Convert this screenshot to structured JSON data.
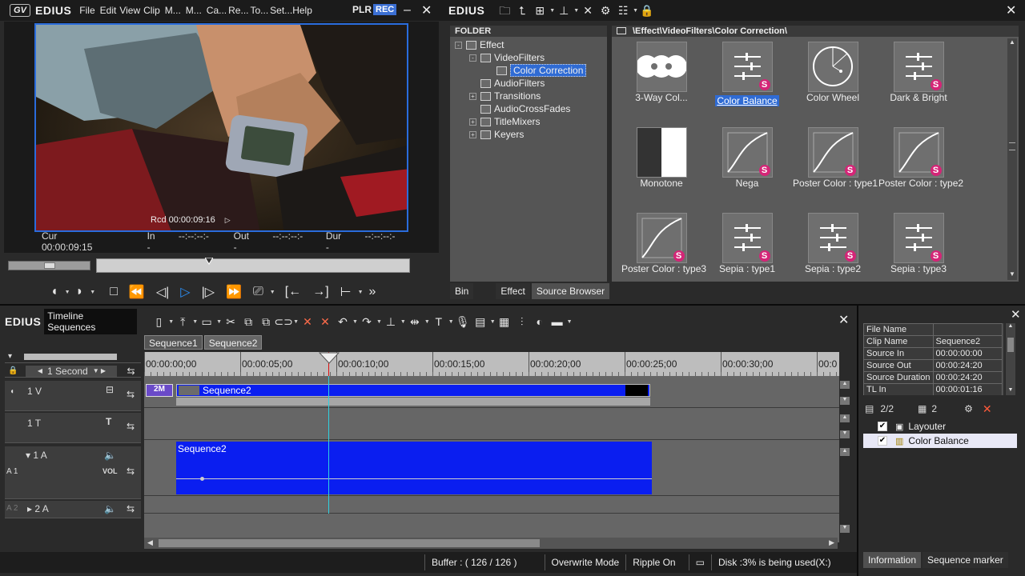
{
  "player": {
    "brand": "EDIUS",
    "logo": "GV",
    "menu": [
      "File",
      "Edit",
      "View",
      "Clip",
      "M...",
      "M...",
      "Ca...",
      "Re...",
      "To...",
      "Set...",
      "Help"
    ],
    "plr": "PLR",
    "rec": "REC",
    "overlay_tc": "Rcd 00:00:09:16",
    "cur_label": "Cur",
    "cur_value": "00:00:09:15",
    "in_label": "In",
    "in_value": "--:--:--:--",
    "out_label": "Out",
    "out_value": "--:--:--:--",
    "dur_label": "Dur",
    "dur_value": "--:--:--:--",
    "scrub_position": 0.36
  },
  "effects": {
    "brand": "EDIUS",
    "folder_header": "FOLDER",
    "path": "\\Effect\\VideoFilters\\Color Correction\\",
    "tree": [
      {
        "label": "Effect",
        "expander": "-"
      },
      {
        "label": "VideoFilters",
        "expander": "-"
      },
      {
        "label": "Color Correction",
        "expander": "",
        "selected": true
      },
      {
        "label": "AudioFilters",
        "expander": ""
      },
      {
        "label": "Transitions",
        "expander": "+"
      },
      {
        "label": "AudioCrossFades",
        "expander": ""
      },
      {
        "label": "TitleMixers",
        "expander": "+"
      },
      {
        "label": "Keyers",
        "expander": "+"
      }
    ],
    "items": [
      {
        "label": "3-Way Col...",
        "icon": "three-circles"
      },
      {
        "label": "Color Balance",
        "icon": "sliders",
        "badge": true,
        "selected": true
      },
      {
        "label": "Color Wheel",
        "icon": "wheel"
      },
      {
        "label": "Dark & Bright",
        "icon": "sliders",
        "badge": true
      },
      {
        "label": "Monotone",
        "icon": "monotone"
      },
      {
        "label": "Nega",
        "icon": "curve",
        "badge": true
      },
      {
        "label": "Poster Color : type1",
        "icon": "curve",
        "badge": true
      },
      {
        "label": "Poster Color : type2",
        "icon": "curve",
        "badge": true
      },
      {
        "label": "Poster Color : type3",
        "icon": "curve",
        "badge": true
      },
      {
        "label": "Sepia : type1",
        "icon": "sliders",
        "badge": true
      },
      {
        "label": "Sepia : type2",
        "icon": "sliders",
        "badge": true
      },
      {
        "label": "Sepia : type3",
        "icon": "sliders",
        "badge": true
      }
    ],
    "badge_letter": "S",
    "tabs": [
      "Bin",
      "Effect",
      "Source Browser"
    ]
  },
  "timeline": {
    "brand": "EDIUS",
    "title": "Timeline Sequences",
    "seq_tabs": [
      "Sequence1",
      "Sequence2"
    ],
    "scale": "1 Second",
    "ruler": [
      "00:00:00;00",
      "00:00:05;00",
      "00:00:10;00",
      "00:00:15;00",
      "00:00:20;00",
      "00:00:25;00",
      "00:00:30;00",
      "00:0"
    ],
    "tracks": {
      "v1": "1 V",
      "t1": "1 T",
      "a1": "1 A",
      "a1_side": "A 1",
      "a1_vol": "VOL",
      "a2": "2 A",
      "a2_side": "A 2"
    },
    "clip_video": "Sequence2",
    "clip_audio": "Sequence2",
    "clip_thumb_text": "2M",
    "status": {
      "buffer": "Buffer : ( 126 / 126 )",
      "mode": "Overwrite Mode",
      "ripple": "Ripple On",
      "disk": "Disk :3% is being used(X:)"
    }
  },
  "info": {
    "rows": [
      [
        "File Name",
        ""
      ],
      [
        "Clip Name",
        "Sequence2"
      ],
      [
        "Source In",
        "00:00:00:00"
      ],
      [
        "Source Out",
        "00:00:24:20"
      ],
      [
        "Source Duration",
        "00:00:24:20"
      ],
      [
        "TL In",
        "00:00:01:16"
      ]
    ],
    "page": "2/2",
    "count": "2",
    "layers": [
      "Layouter",
      "Color Balance"
    ],
    "tabs": [
      "Information",
      "Sequence marker"
    ]
  },
  "colors": {
    "accent": "#2f6bd4",
    "clip": "#0a1ef0",
    "badge": "#d42577",
    "rec": "#3b6fd3"
  }
}
